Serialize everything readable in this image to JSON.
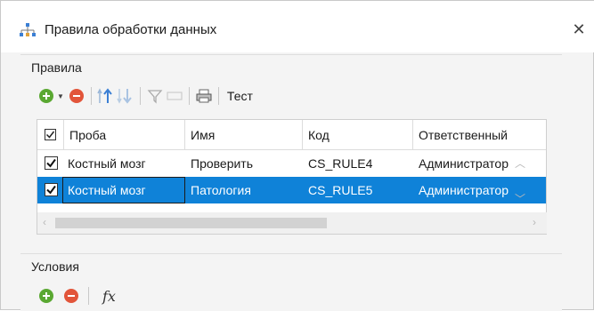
{
  "window": {
    "title": "Правила обработки данных",
    "close_glyph": "✕"
  },
  "rules_group": {
    "title": "Правила",
    "toolbar": {
      "test_label": "Тест"
    },
    "grid": {
      "columns": [
        "Проба",
        "Имя",
        "Код",
        "Ответственный"
      ],
      "rows": [
        {
          "checked": true,
          "sample": "Костный мозг",
          "name": "Проверить",
          "code": "CS_RULE4",
          "owner": "Администратор",
          "selected": false
        },
        {
          "checked": true,
          "sample": "Костный мозг",
          "name": "Патология",
          "code": "CS_RULE5",
          "owner": "Администратор",
          "selected": true
        }
      ]
    }
  },
  "conditions_group": {
    "title": "Условия",
    "fx_label": "fx"
  },
  "colors": {
    "selection": "#0f82d8",
    "add_green": "#5aa832",
    "remove_red": "#e2553a",
    "arrow_blue": "#3b7fd4"
  }
}
